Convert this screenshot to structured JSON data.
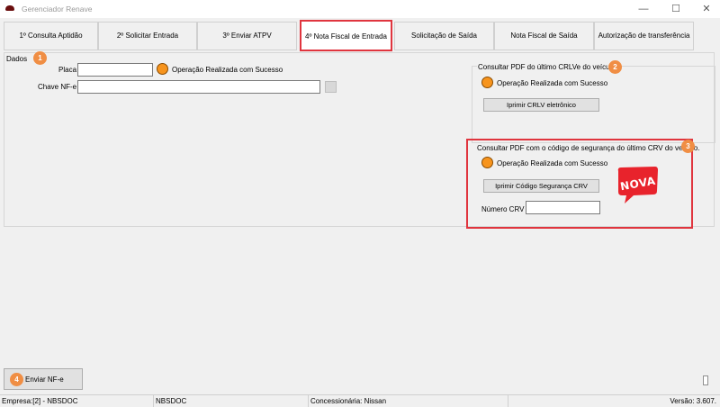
{
  "window": {
    "title": "Gerenciador Renave"
  },
  "tabs": [
    {
      "label": "1º Consulta Aptidão"
    },
    {
      "label": "2º Solicitar Entrada"
    },
    {
      "label": "3º Enviar ATPV"
    },
    {
      "label": "4º Nota Fiscal de Entrada"
    },
    {
      "label": "Solicitação de Saída"
    },
    {
      "label": "Nota Fiscal de Saída"
    },
    {
      "label": "Autorização de transferência"
    }
  ],
  "dados": {
    "group_label": "Dados",
    "badge": "1",
    "placa_label": "Placa",
    "placa_value": "",
    "status_text": "Operação Realizada com Sucesso",
    "chave_label": "Chave NF-e",
    "chave_value": ""
  },
  "crlv": {
    "title": "Consultar PDF do último CRLVe do veículo.",
    "badge": "2",
    "status_text": "Operação Realizada com Sucesso",
    "button_label": "Iprimir CRLV eletrônico"
  },
  "crv": {
    "title": "Consultar PDF com o código de segurança do último CRV do veículo.",
    "badge": "3",
    "status_text": "Operação Realizada com Sucesso",
    "button_label": "Iprimir Código Segurança CRV",
    "numero_label": "Número CRV",
    "numero_value": "",
    "new_tag": "NOVA"
  },
  "bottom": {
    "badge": "4",
    "send_button_label": "Enviar NF-e"
  },
  "statusbar": {
    "empresa": "Empresa:[2] - NBSDOC",
    "db": "NBSDOC",
    "concessionaria": "Concessionária: Nissan",
    "versao": "Versão: 3.607."
  },
  "colors": {
    "accent_red": "#e0353e",
    "status_orange": "#f7941d",
    "badge_orange": "#f08e44"
  }
}
